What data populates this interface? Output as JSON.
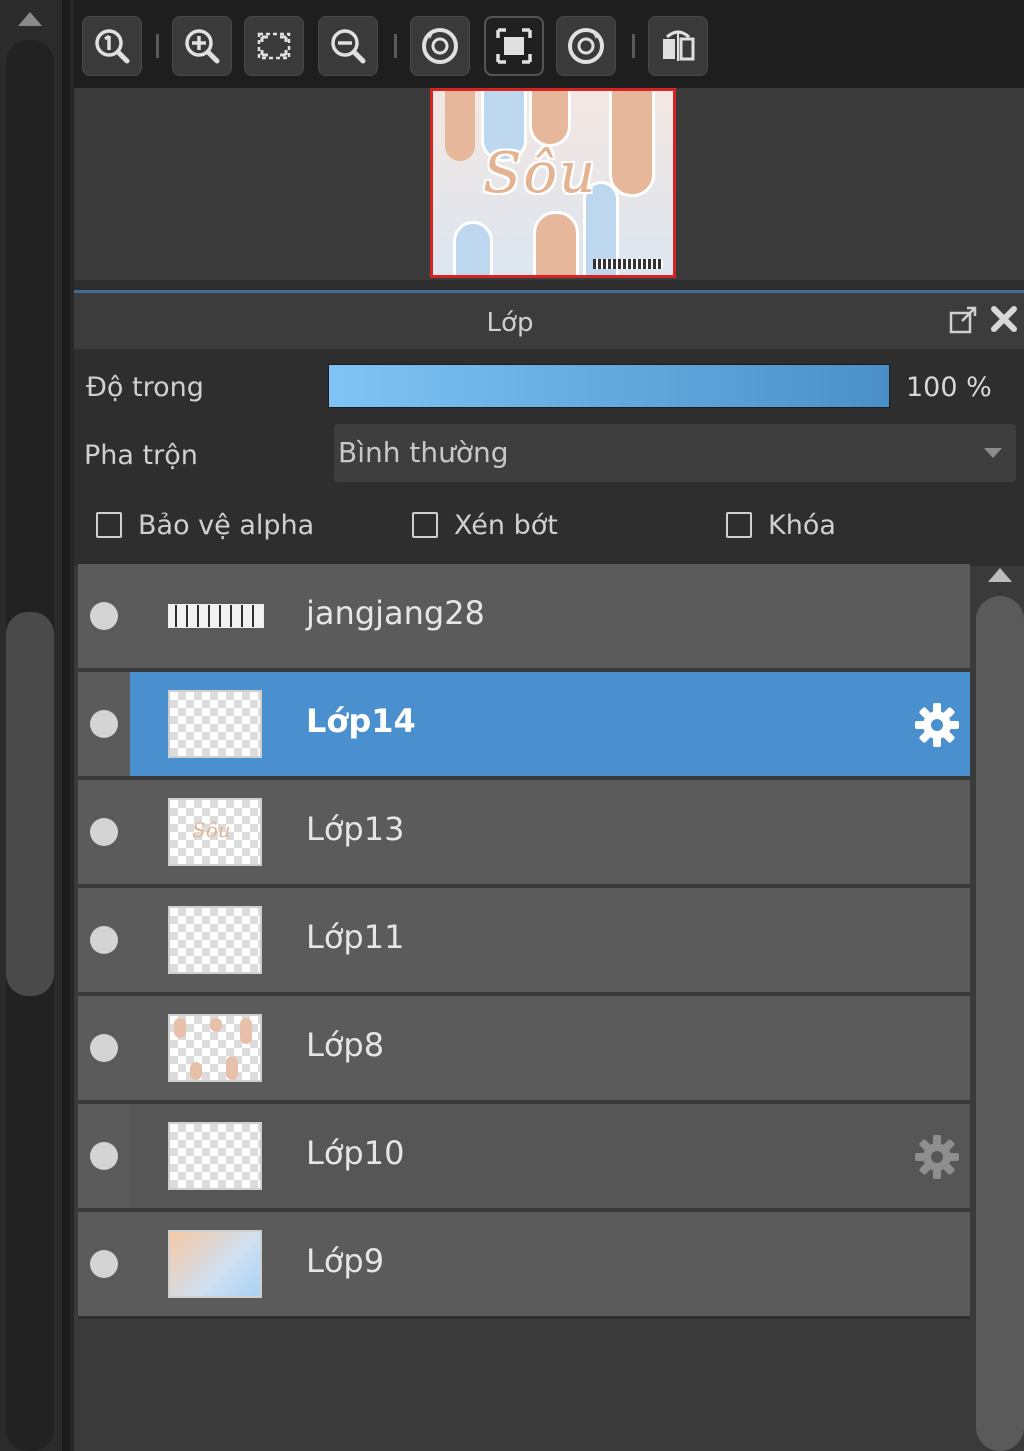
{
  "toolbar": {
    "buttons": [
      {
        "icon": "zoom-actual-icon"
      },
      {
        "icon": "zoom-in-icon"
      },
      {
        "icon": "fit-screen-icon"
      },
      {
        "icon": "zoom-out-icon"
      },
      {
        "icon": "rotate-left-icon"
      },
      {
        "icon": "fit-frame-icon"
      },
      {
        "icon": "rotate-right-icon"
      },
      {
        "icon": "flip-icon"
      }
    ]
  },
  "navigator": {
    "preview_word": "Sôu",
    "accent": "#d42424"
  },
  "panel": {
    "title": "Lớp"
  },
  "properties": {
    "opacity_label": "Độ trong",
    "opacity_value": "100 %",
    "opacity_fraction": 1.0,
    "blend_label": "Pha trộn",
    "blend_value": "Bình thường",
    "protect_alpha_label": "Bảo vệ alpha",
    "clipping_label": "Xén bớt",
    "lock_label": "Khóa"
  },
  "layers": [
    {
      "name": "jangjang28",
      "selected": false,
      "gear": false
    },
    {
      "name": "Lớp14",
      "selected": true,
      "gear": true
    },
    {
      "name": "Lớp13",
      "selected": false,
      "gear": false
    },
    {
      "name": "Lớp11",
      "selected": false,
      "gear": false
    },
    {
      "name": "Lớp8",
      "selected": false,
      "gear": false
    },
    {
      "name": "Lớp10",
      "selected": false,
      "gear": true
    },
    {
      "name": "Lớp9",
      "selected": false,
      "gear": false
    }
  ],
  "colors": {
    "selection": "#4a90cf",
    "opacity_gradient_start": "#7fc4f4",
    "opacity_gradient_end": "#4a8fc8"
  }
}
